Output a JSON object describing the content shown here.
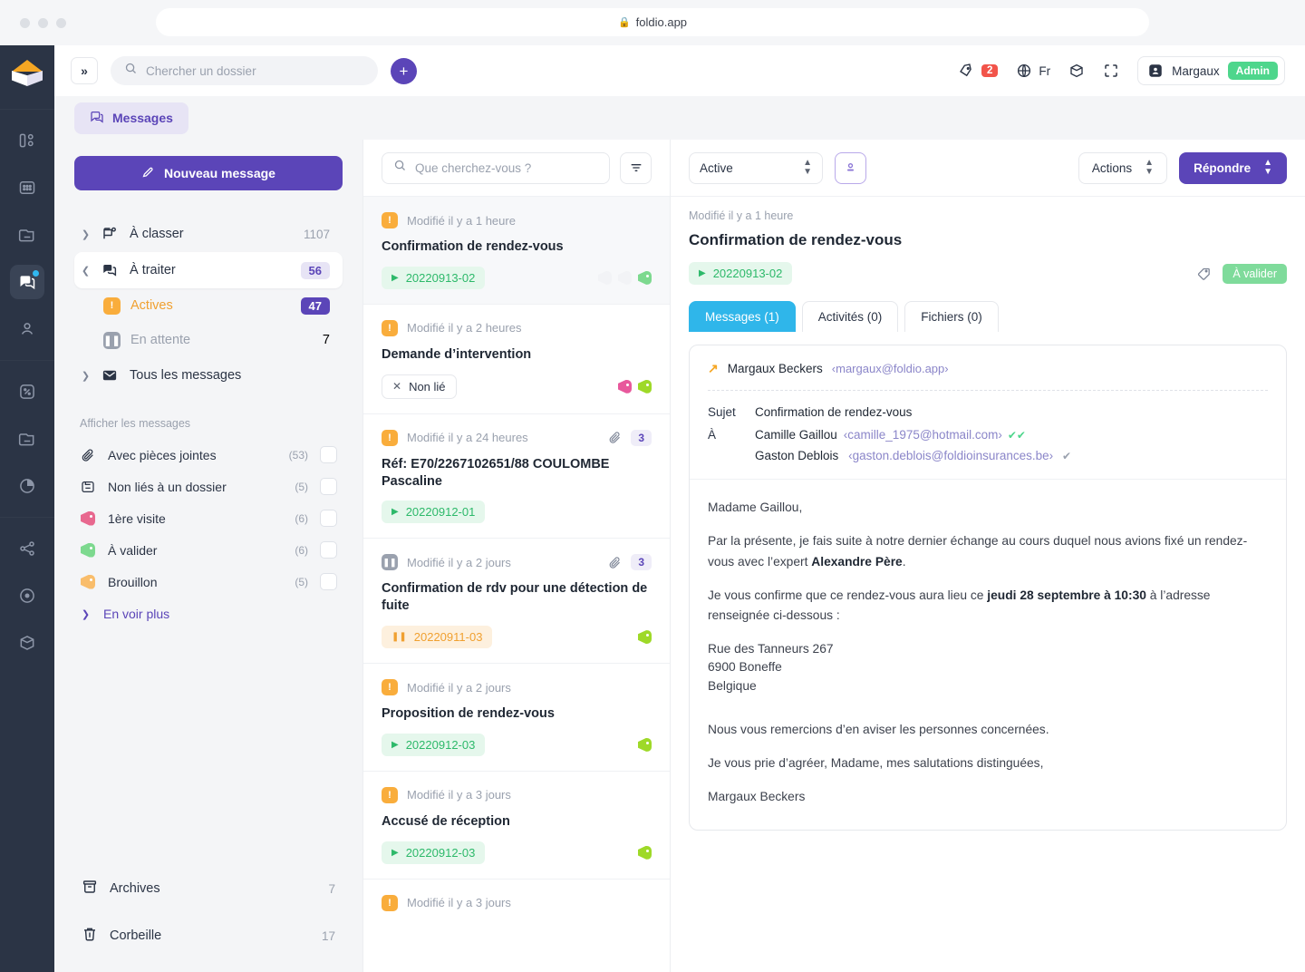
{
  "browser": {
    "url": "foldio.app",
    "lock_icon": "lock-icon"
  },
  "topbar": {
    "collapse_label": "»",
    "search_placeholder": "Chercher un dossier",
    "search_value": "",
    "add_label": "+",
    "notifications_count": "2",
    "language": "Fr",
    "user_name": "Margaux",
    "user_role": "Admin",
    "icons": [
      "bell-tag-icon",
      "globe-icon",
      "cube-icon",
      "fullscreen-icon",
      "avatar-icon"
    ]
  },
  "rail": {
    "logo": "foldio-logo",
    "items": [
      {
        "name": "dashboard-icon",
        "active": false
      },
      {
        "name": "grid-icon",
        "active": false
      },
      {
        "name": "folder-icon",
        "active": false
      },
      {
        "name": "messages-icon",
        "active": true,
        "dot": true
      },
      {
        "name": "contacts-icon",
        "active": false
      },
      {
        "name": "percent-icon",
        "active": false
      },
      {
        "name": "document-icon",
        "active": false
      },
      {
        "name": "pie-chart-icon",
        "active": false
      },
      {
        "name": "share-icon",
        "active": false
      },
      {
        "name": "target-icon",
        "active": false
      },
      {
        "name": "box-icon",
        "active": false
      }
    ]
  },
  "module_tab": {
    "label": "Messages",
    "icon": "messages-icon"
  },
  "sidebar": {
    "new_message_label": "Nouveau message",
    "folders": [
      {
        "label": "À classer",
        "count": "1107",
        "icon": "inbox-new-icon",
        "expanded": false,
        "selected": false,
        "count_style": "plain"
      },
      {
        "label": "À traiter",
        "count": "56",
        "icon": "stacked-messages-icon",
        "expanded": true,
        "selected": true,
        "count_style": "light"
      }
    ],
    "sub_items": [
      {
        "label": "Actives",
        "count": "47",
        "icon": "alert-square-icon",
        "active": true,
        "count_style": "solid"
      },
      {
        "label": "En attente",
        "count": "7",
        "icon": "pause-square-icon",
        "active": false,
        "count_style": "plain"
      }
    ],
    "all_messages": {
      "label": "Tous les messages",
      "icon": "envelope-icon"
    },
    "filters_title": "Afficher les messages",
    "filters": [
      {
        "label": "Avec pièces jointes",
        "count": "(53)",
        "icon": "paperclip-icon",
        "color": ""
      },
      {
        "label": "Non liés à un dossier",
        "count": "(5)",
        "icon": "unlinked-folder-icon",
        "color": ""
      },
      {
        "label": "1ère visite",
        "count": "(6)",
        "icon": "tag-icon",
        "color": "#e8688f"
      },
      {
        "label": "À valider",
        "count": "(6)",
        "icon": "tag-icon",
        "color": "#7dd98f"
      },
      {
        "label": "Brouillon",
        "count": "(5)",
        "icon": "tag-icon",
        "color": "#f9bd6b"
      }
    ],
    "see_more": "En voir plus",
    "bottom": [
      {
        "label": "Archives",
        "count": "7",
        "icon": "archive-icon"
      },
      {
        "label": "Corbeille",
        "count": "17",
        "icon": "trash-icon"
      }
    ]
  },
  "list": {
    "search_placeholder": "Que cherchez-vous ?",
    "search_value": "",
    "filter_icon": "filter-icon",
    "items": [
      {
        "status_icon": "alert-square-icon",
        "status_kind": "warn",
        "time": "Modifié il y a 1 heure",
        "title": "Confirmation de rendez-vous",
        "ref": "20220913-02",
        "ref_kind": "green",
        "ref_glyph": "▶",
        "attachment": false,
        "count": "",
        "tags": [
          "#f2f3f6",
          "#f2f3f6",
          "#7dd98f"
        ],
        "selected": true
      },
      {
        "status_icon": "alert-square-icon",
        "status_kind": "warn",
        "time": "Modifié il y a 2 heures",
        "title": "Demande d’intervention",
        "ref": "Non lié",
        "ref_kind": "nonlie",
        "ref_glyph": "✕",
        "attachment": false,
        "count": "",
        "tags": [
          "#e8589c",
          "#9ed928"
        ],
        "selected": false
      },
      {
        "status_icon": "alert-square-icon",
        "status_kind": "warn",
        "time": "Modifié il y a 24 heures",
        "title": "Réf: E70/2267102651/88 COULOMBE Pascaline",
        "ref": "20220912-01",
        "ref_kind": "green",
        "ref_glyph": "▶",
        "attachment": true,
        "count": "3",
        "tags": [],
        "selected": false
      },
      {
        "status_icon": "pause-square-icon",
        "status_kind": "pause",
        "time": "Modifié il y a 2 jours",
        "title": "Confirmation de rdv pour une détection de fuite",
        "ref": "20220911-03",
        "ref_kind": "orange",
        "ref_glyph": "‖",
        "attachment": true,
        "count": "3",
        "tags": [
          "#9ed928"
        ],
        "selected": false
      },
      {
        "status_icon": "alert-square-icon",
        "status_kind": "warn",
        "time": "Modifié il y a 2 jours",
        "title": "Proposition de rendez-vous",
        "ref": "20220912-03",
        "ref_kind": "green",
        "ref_glyph": "▶",
        "attachment": false,
        "count": "",
        "tags": [
          "#9ed928"
        ],
        "selected": false
      },
      {
        "status_icon": "alert-square-icon",
        "status_kind": "warn",
        "time": "Modifié il y a 3 jours",
        "title": "Accusé de réception",
        "ref": "20220912-03",
        "ref_kind": "green",
        "ref_glyph": "▶",
        "attachment": false,
        "count": "",
        "tags": [
          "#9ed928"
        ],
        "selected": false
      },
      {
        "status_icon": "alert-square-icon",
        "status_kind": "warn",
        "time": "Modifié il y a 3 jours",
        "title": "",
        "ref": "",
        "ref_kind": "",
        "ref_glyph": "",
        "attachment": false,
        "count": "",
        "tags": [],
        "selected": false
      }
    ]
  },
  "detail": {
    "status_select": "Active",
    "assign_icon": "assign-user-icon",
    "actions_label": "Actions",
    "reply_label": "Répondre",
    "time": "Modifié il y a 1 heure",
    "title": "Confirmation de rendez-vous",
    "ref": "20220913-02",
    "ref_glyph": "▶",
    "tag_icon": "tag-outline-icon",
    "badge": "À valider",
    "tabs": [
      {
        "label": "Messages (1)",
        "active": true
      },
      {
        "label": "Activités (0)",
        "active": false
      },
      {
        "label": "Fichiers (0)",
        "active": false
      }
    ],
    "mail": {
      "from_name": "Margaux Beckers",
      "from_email": "‹margaux@foldio.app›",
      "direction_icon": "arrow-outgoing-icon",
      "subject_key": "Sujet",
      "subject_value": "Confirmation de rendez-vous",
      "to_key": "À",
      "recipients": [
        {
          "name": "Camille Gaillou",
          "email": "‹camille_1975@hotmail.com›",
          "status": "✔✔",
          "status_color": "#4ed68c"
        },
        {
          "name": "Gaston Deblois",
          "email": "‹gaston.deblois@foldioinsurances.be›",
          "status": "✔",
          "status_color": "#9aa1ae"
        }
      ],
      "body": {
        "greeting": "Madame Gaillou,",
        "p1_before": "Par la présente, je fais suite à notre dernier échange au cours duquel nous avions fixé un rendez-vous avec l’expert ",
        "p1_bold": "Alexandre Père",
        "p1_after": ".",
        "p2_before": "Je vous confirme que ce rendez-vous aura lieu ce ",
        "p2_bold": "jeudi 28 septembre à 10:30",
        "p2_after": " à l’adresse renseignée ci-dessous :",
        "address_line1": "Rue des Tanneurs 267",
        "address_line2": "6900 Boneffe",
        "address_line3": "Belgique",
        "p3": "Nous vous remercions d’en aviser les personnes concernées.",
        "p4": "Je vous prie d’agréer, Madame, mes salutations distinguées,",
        "signature": "Margaux Beckers"
      }
    }
  },
  "colors": {
    "primary": "#5b45b8",
    "accent_blue": "#2fb6ea",
    "warn": "#f9ad3c",
    "green": "#2db96a",
    "danger": "#f2544a",
    "rail_bg": "#2b3445"
  }
}
